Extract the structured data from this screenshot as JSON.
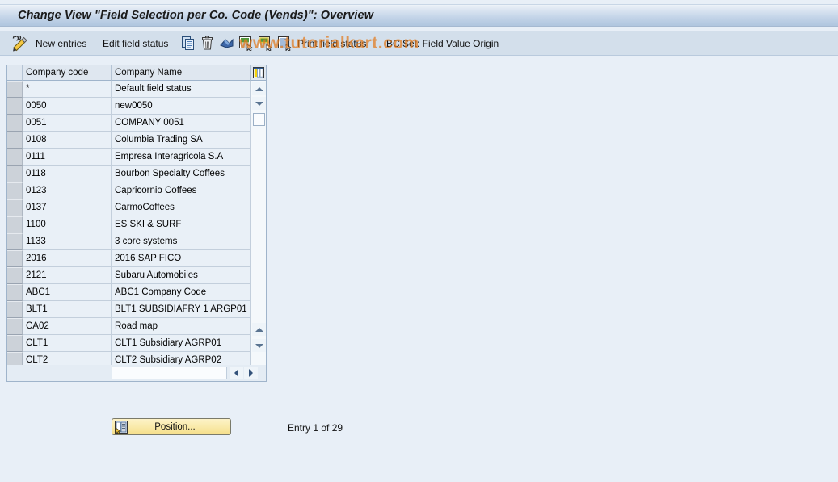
{
  "window": {
    "title": "Change View \"Field Selection per Co. Code (Vends)\": Overview"
  },
  "watermark": {
    "text": "www.tutorialkart.com"
  },
  "toolbar": {
    "items": [
      {
        "type": "icon",
        "name": "edit-pencil-icon",
        "label": ""
      },
      {
        "type": "label",
        "name": "new-entries-button",
        "label": "New entries"
      },
      {
        "type": "label",
        "name": "edit-field-status-button",
        "label": "Edit field status"
      },
      {
        "type": "icon",
        "name": "copy-icon",
        "label": ""
      },
      {
        "type": "icon",
        "name": "delete-trash-icon",
        "label": ""
      },
      {
        "type": "icon",
        "name": "undo-icon",
        "label": ""
      },
      {
        "type": "icon",
        "name": "select-all-icon",
        "label": ""
      },
      {
        "type": "icon",
        "name": "deselect-all-icon",
        "label": ""
      },
      {
        "type": "icon",
        "name": "select-block-icon",
        "label": ""
      },
      {
        "type": "label",
        "name": "print-field-status-button",
        "label": "Print field status"
      },
      {
        "type": "label",
        "name": "bc-set-field-value-origin-button",
        "label": "BC Set: Field Value Origin"
      }
    ]
  },
  "table": {
    "columns": [
      {
        "key": "code",
        "label": "Company code"
      },
      {
        "key": "name",
        "label": "Company Name"
      }
    ],
    "config_icon": "column-settings-icon",
    "rows": [
      {
        "code": "*",
        "name": "Default field status"
      },
      {
        "code": "0050",
        "name": "new0050"
      },
      {
        "code": "0051",
        "name": "COMPANY 0051"
      },
      {
        "code": "0108",
        "name": "Columbia Trading SA"
      },
      {
        "code": "0111",
        "name": "Empresa Interagricola S.A"
      },
      {
        "code": "0118",
        "name": "Bourbon Specialty Coffees"
      },
      {
        "code": "0123",
        "name": "Capricornio Coffees"
      },
      {
        "code": "0137",
        "name": "CarmoCoffees"
      },
      {
        "code": "1100",
        "name": "ES SKI & SURF"
      },
      {
        "code": "1133",
        "name": "3 core systems"
      },
      {
        "code": "2016",
        "name": "2016 SAP FICO"
      },
      {
        "code": "2121",
        "name": "Subaru Automobiles"
      },
      {
        "code": "ABC1",
        "name": "ABC1 Company Code"
      },
      {
        "code": "BLT1",
        "name": "BLT1 SUBSIDIAFRY 1 ARGP01"
      },
      {
        "code": "CA02",
        "name": "Road map"
      },
      {
        "code": "CLT1",
        "name": "CLT1 Subsidiary AGRP01"
      },
      {
        "code": "CLT2",
        "name": "CLT2 Subsidiary AGRP02"
      }
    ]
  },
  "footer": {
    "position_button_label": "Position...",
    "position_button_icon": "position-list-icon",
    "entry_counter": "Entry 1 of 29"
  },
  "colors": {
    "page_background": "#e8eff7",
    "title_bar_gradient_top": "#eef3f9",
    "title_bar_gradient_bottom": "#b0c6df",
    "toolbar_background": "#d3dfeb",
    "grid_header_background": "#dfe7f0",
    "grid_cell_background": "#e9f0f7",
    "row_selector_background": "#ccd2d9",
    "button_yellow": "#f9e9a8",
    "watermark_orange": "#e27a1c"
  }
}
